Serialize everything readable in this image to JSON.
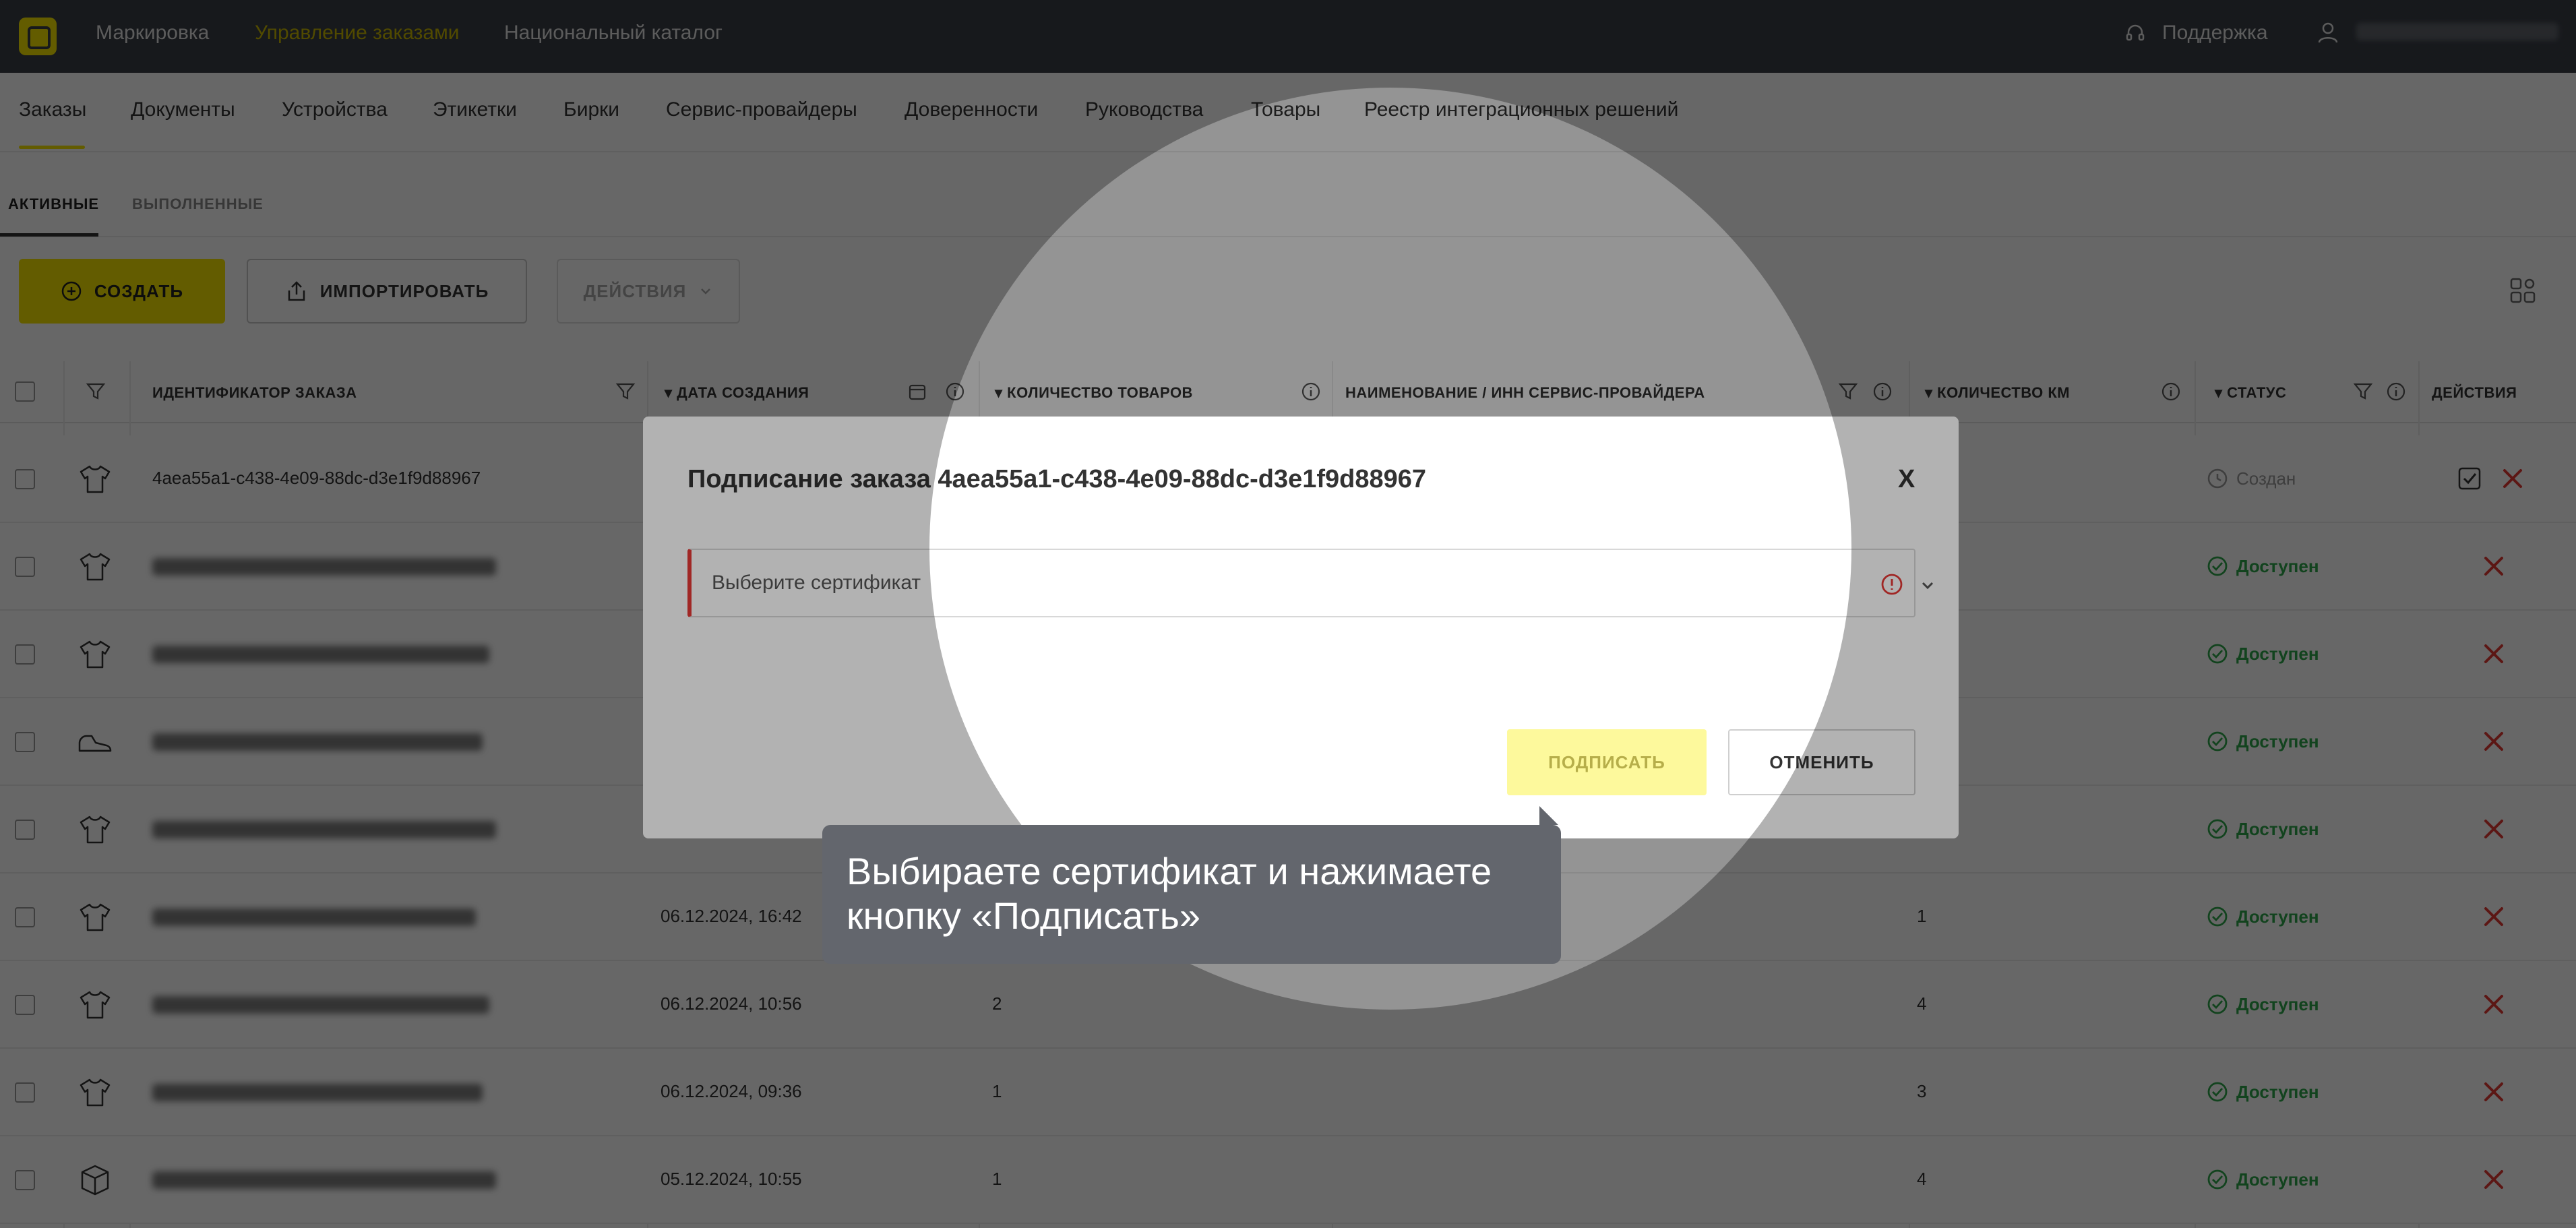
{
  "topnav": {
    "items": [
      "Маркировка",
      "Управление заказами",
      "Национальный каталог"
    ],
    "support": "Поддержка"
  },
  "tabs": [
    "Заказы",
    "Документы",
    "Устройства",
    "Этикетки",
    "Бирки",
    "Сервис-провайдеры",
    "Доверенности",
    "Руководства",
    "Товары",
    "Реестр интеграционных решений"
  ],
  "subtabs": [
    "АКТИВНЫЕ",
    "ВЫПОЛНЕННЫЕ"
  ],
  "toolbar": {
    "create": "СОЗДАТЬ",
    "import": "ИМПОРТИРОВАТЬ",
    "actions": "ДЕЙСТВИЯ"
  },
  "table": {
    "headers": {
      "id": "ИДЕНТИФИКАТОР ЗАКАЗА",
      "date": "ДАТА СОЗДАНИЯ",
      "qty": "КОЛИЧЕСТВО ТОВАРОВ",
      "provider": "НАИМЕНОВАНИЕ / ИНН СЕРВИС-ПРОВАЙДЕРА",
      "km": "КОЛИЧЕСТВО КМ",
      "status": "СТАТУС",
      "actions": "ДЕЙСТВИЯ"
    },
    "rows": [
      {
        "id": "4aea55a1-c438-4e09-88dc-d3e1f9d88967",
        "date": "",
        "qty": "",
        "km": "",
        "status": "Создан"
      },
      {
        "id": "",
        "date": "",
        "qty": "",
        "km": "",
        "status": "Доступен"
      },
      {
        "id": "",
        "date": "",
        "qty": "",
        "km": "",
        "status": "Доступен"
      },
      {
        "id": "",
        "date": "",
        "qty": "",
        "km": "",
        "status": "Доступен"
      },
      {
        "id": "",
        "date": "",
        "qty": "",
        "km": "",
        "status": "Доступен"
      },
      {
        "id": "",
        "date": "06.12.2024, 16:42",
        "qty": "",
        "km": "1",
        "status": "Доступен"
      },
      {
        "id": "",
        "date": "06.12.2024, 10:56",
        "qty": "2",
        "km": "4",
        "status": "Доступен"
      },
      {
        "id": "",
        "date": "06.12.2024, 09:36",
        "qty": "1",
        "km": "3",
        "status": "Доступен"
      },
      {
        "id": "",
        "date": "05.12.2024, 10:55",
        "qty": "1",
        "km": "4",
        "status": "Доступен"
      }
    ]
  },
  "modal": {
    "title": "Подписание заказа 4aea55a1-c438-4e09-88dc-d3e1f9d88967",
    "close": "X",
    "cert_placeholder": "Выберите сертификат",
    "sign": "ПОДПИСАТЬ",
    "cancel": "ОТМЕНИТЬ"
  },
  "tooltip": {
    "text": "Выбираете сертификат и нажимаете кнопку «Подписать»"
  },
  "colors": {
    "accent": "#f5e600",
    "topbar": "#3a3f47",
    "ok": "#2ea84a",
    "error": "#e53935"
  }
}
